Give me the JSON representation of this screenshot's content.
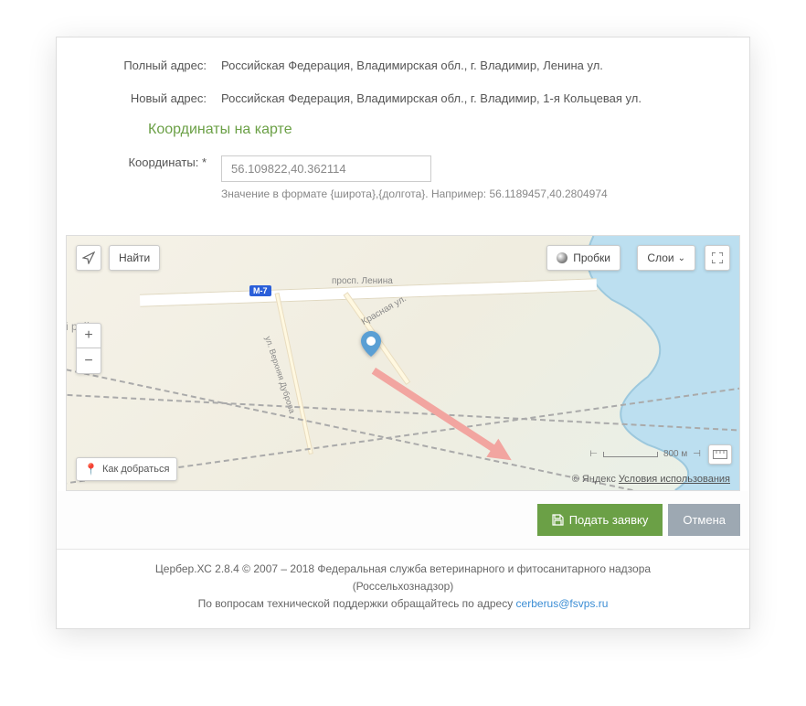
{
  "form": {
    "full_address_label": "Полный адрес:",
    "full_address_value": "Российская Федерация, Владимирская обл., г. Владимир, Ленина ул.",
    "new_address_label": "Новый адрес:",
    "new_address_value": "Российская Федерация, Владимирская обл., г. Владимир, 1-я Кольцевая ул.",
    "coords_section_title": "Координаты на карте",
    "coords_label": "Координаты: *",
    "coords_value": "56.109822,40.362114",
    "coords_hint": "Значение в формате {широта},{долгота}. Например: 56.1189457,40.2804974"
  },
  "map": {
    "find_label": "Найти",
    "traffic_label": "Пробки",
    "layers_label": "Слои",
    "route_label": "Как добраться",
    "region_label": "й район",
    "road_shield": "М-7",
    "road_lenina": "просп. Ленина",
    "road_krasnaya": "Красная ул.",
    "road_dubrova": "ул. Верхняя Дуброва",
    "scale_label": "800 м",
    "copyright_prefix": "© Яндекс ",
    "terms_link": "Условия использования"
  },
  "actions": {
    "submit": "Подать заявку",
    "cancel": "Отмена"
  },
  "footer": {
    "line1": "Цербер.ХС 2.8.4 © 2007 – 2018 Федеральная служба ветеринарного и фитосанитарного надзора",
    "line2": "(Россельхознадзор)",
    "support_text": "По вопросам технической поддержки обращайтесь по адресу ",
    "support_email": "cerberus@fsvps.ru"
  }
}
